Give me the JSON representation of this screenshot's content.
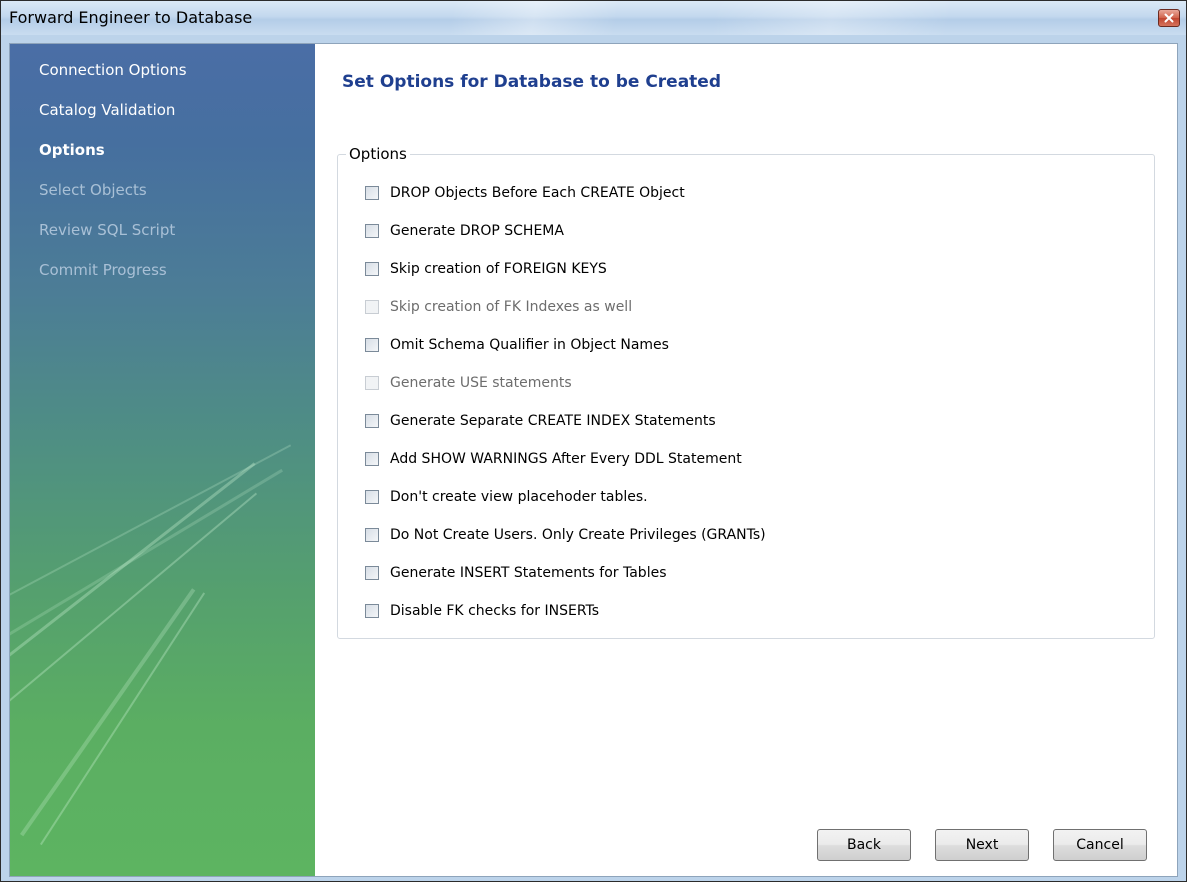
{
  "window": {
    "title": "Forward Engineer to Database"
  },
  "sidebar": {
    "items": [
      {
        "label": "Connection Options",
        "state": "done"
      },
      {
        "label": "Catalog Validation",
        "state": "done"
      },
      {
        "label": "Options",
        "state": "current"
      },
      {
        "label": "Select Objects",
        "state": "future"
      },
      {
        "label": "Review SQL Script",
        "state": "future"
      },
      {
        "label": "Commit Progress",
        "state": "future"
      }
    ]
  },
  "main": {
    "heading": "Set Options for Database to be Created",
    "group_label": "Options",
    "options": [
      {
        "label": "DROP Objects Before Each CREATE Object",
        "checked": false,
        "enabled": true
      },
      {
        "label": "Generate DROP SCHEMA",
        "checked": false,
        "enabled": true
      },
      {
        "label": "Skip creation of FOREIGN KEYS",
        "checked": false,
        "enabled": true
      },
      {
        "label": "Skip creation of FK Indexes as well",
        "checked": false,
        "enabled": false
      },
      {
        "label": "Omit Schema Qualifier in Object Names",
        "checked": false,
        "enabled": true
      },
      {
        "label": "Generate USE statements",
        "checked": false,
        "enabled": false
      },
      {
        "label": "Generate Separate CREATE INDEX Statements",
        "checked": false,
        "enabled": true
      },
      {
        "label": "Add SHOW WARNINGS After Every DDL Statement",
        "checked": false,
        "enabled": true
      },
      {
        "label": "Don't create view placehoder tables.",
        "checked": false,
        "enabled": true
      },
      {
        "label": "Do Not Create Users. Only Create Privileges (GRANTs)",
        "checked": false,
        "enabled": true
      },
      {
        "label": "Generate INSERT Statements for Tables",
        "checked": false,
        "enabled": true
      },
      {
        "label": "Disable FK checks for INSERTs",
        "checked": false,
        "enabled": true
      }
    ]
  },
  "buttons": {
    "back": "Back",
    "next": "Next",
    "cancel": "Cancel"
  },
  "colors": {
    "heading": "#1f3f8f",
    "sidebar_top": "#4a6ea6",
    "sidebar_bottom": "#5db461",
    "close_button": "#c04530"
  },
  "icons": {
    "close": "close-icon"
  }
}
